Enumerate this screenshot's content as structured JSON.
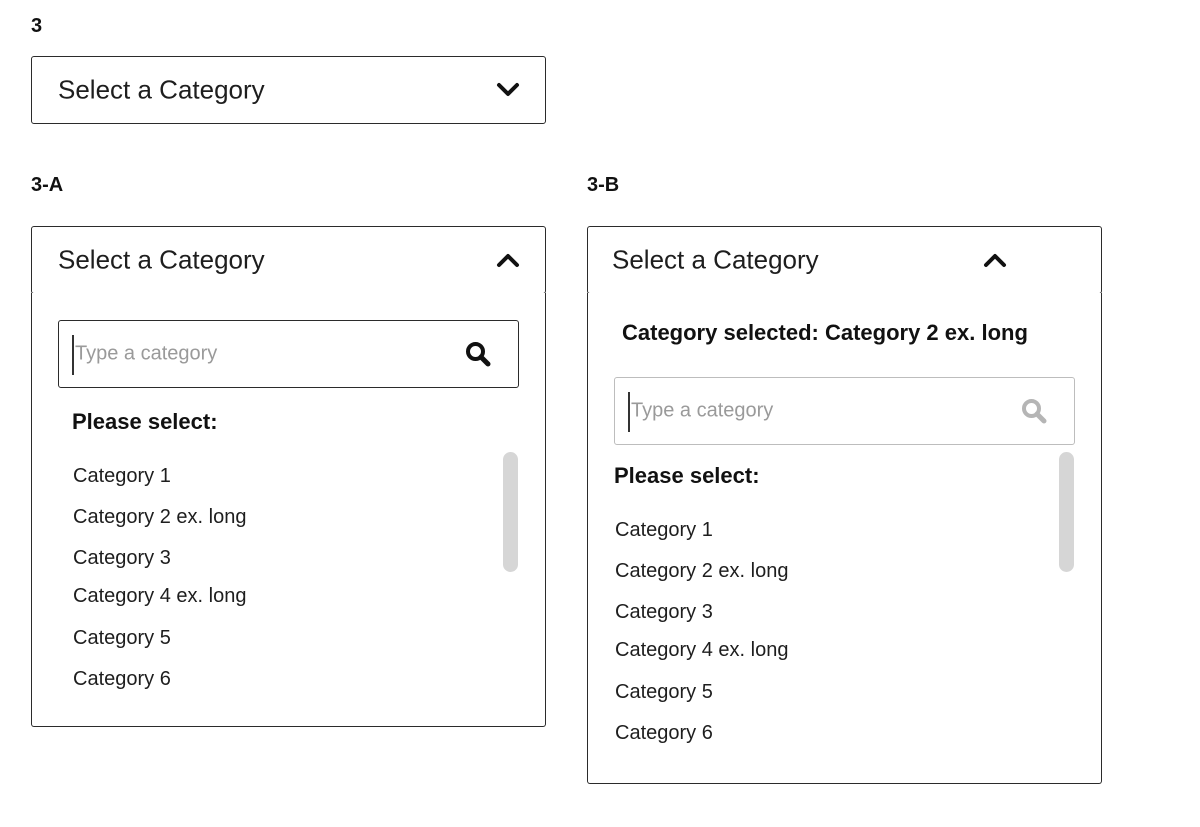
{
  "variants": {
    "base": {
      "label": "3",
      "select_text": "Select a Category",
      "chevron_icon": "chevron-down-icon"
    },
    "a": {
      "label": "3-A",
      "select_text": "Select a Category",
      "chevron_icon": "chevron-up-icon",
      "search_placeholder": "Type a category",
      "search_icon": "search-icon",
      "prompt": "Please select:",
      "options": [
        "Category 1",
        "Category 2 ex. long",
        "Category 3",
        "Category 4 ex. long",
        "Category 5",
        "Category 6"
      ]
    },
    "b": {
      "label": "3-B",
      "select_text": "Select a Category",
      "chevron_icon": "chevron-up-icon",
      "selected_note": "Category selected: Category 2 ex. long",
      "search_placeholder": "Type a category",
      "search_icon": "search-icon",
      "prompt": "Please select:",
      "options": [
        "Category 1",
        "Category 2 ex. long",
        "Category 3",
        "Category 4 ex. long",
        "Category 5",
        "Category 6"
      ]
    }
  },
  "colors": {
    "border": "#2b2b2b",
    "placeholder": "#9a9a9a",
    "disabled_icon": "#b5b5b5",
    "scrollbar": "#d6d6d6"
  }
}
